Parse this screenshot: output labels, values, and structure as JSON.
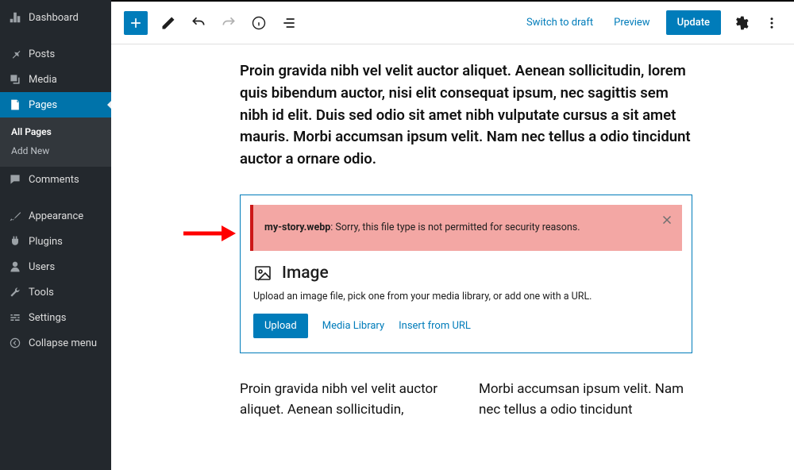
{
  "sidebar": {
    "items": [
      {
        "label": "Dashboard"
      },
      {
        "label": "Posts"
      },
      {
        "label": "Media"
      },
      {
        "label": "Pages"
      },
      {
        "label": "Comments"
      },
      {
        "label": "Appearance"
      },
      {
        "label": "Plugins"
      },
      {
        "label": "Users"
      },
      {
        "label": "Tools"
      },
      {
        "label": "Settings"
      },
      {
        "label": "Collapse menu"
      }
    ],
    "submenu": {
      "all": "All Pages",
      "add": "Add New"
    }
  },
  "topbar": {
    "switch_to_draft": "Switch to draft",
    "preview": "Preview",
    "update": "Update"
  },
  "content": {
    "paragraph_top": "Proin gravida nibh vel velit auctor aliquet. Aenean sollicitudin, lorem quis bibendum auctor, nisi elit consequat ipsum, nec sagittis sem nibh id elit. Duis sed odio sit amet nibh vulputate cursus a sit amet mauris. Morbi accumsan ipsum velit. Nam nec tellus a odio tincidunt auctor a ornare odio.",
    "col_left": "Proin gravida nibh vel velit auctor aliquet. Aenean sollicitudin,",
    "col_right": "Morbi accumsan ipsum velit. Nam nec tellus a odio tincidunt"
  },
  "image_block": {
    "error_filename": "my-story.webp",
    "error_message": ": Sorry, this file type is not permitted for security reasons.",
    "title": "Image",
    "help": "Upload an image file, pick one from your media library, or add one with a URL.",
    "upload": "Upload",
    "media_library": "Media Library",
    "insert_url": "Insert from URL"
  }
}
